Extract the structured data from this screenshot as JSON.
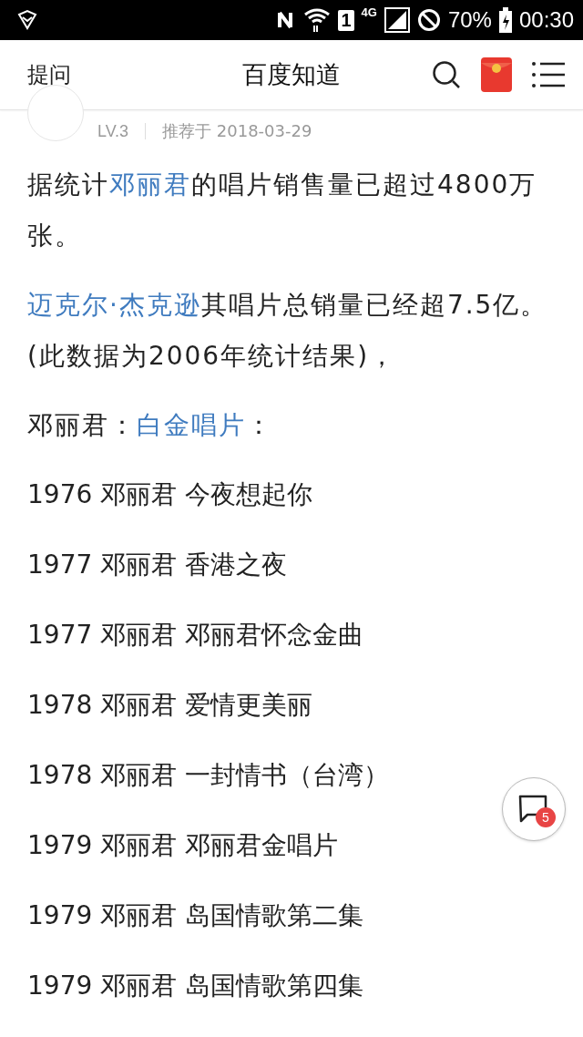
{
  "status_bar": {
    "battery": "70%",
    "time": "00:30",
    "network": "4G",
    "sim": "1"
  },
  "header": {
    "left": "提问",
    "title": "百度知道"
  },
  "answer_meta": {
    "level": "LV.3",
    "date": "推荐于 2018-03-29"
  },
  "paragraphs": [
    [
      {
        "text": "据统计"
      },
      {
        "text": "邓丽君",
        "link": true
      },
      {
        "text": "的唱片销售量已超过4800万张。"
      }
    ],
    [
      {
        "text": "迈克尔·杰克逊",
        "link": true
      },
      {
        "text": "其唱片总销量已经超7.5亿。(此数据为2006年统计结果)，"
      }
    ],
    [
      {
        "text": "邓丽君："
      },
      {
        "text": "白金唱片",
        "link": true
      },
      {
        "text": "："
      }
    ]
  ],
  "records": [
    "1976 邓丽君 今夜想起你",
    "1977 邓丽君 香港之夜",
    "1977 邓丽君 邓丽君怀念金曲",
    "1978 邓丽君 爱情更美丽",
    "1978 邓丽君 一封情书（台湾）",
    "1979 邓丽君 邓丽君金唱片",
    "1979 邓丽君 岛国情歌第二集",
    "1979 邓丽君 岛国情歌第四集"
  ],
  "comment_button": {
    "badge": "5"
  }
}
